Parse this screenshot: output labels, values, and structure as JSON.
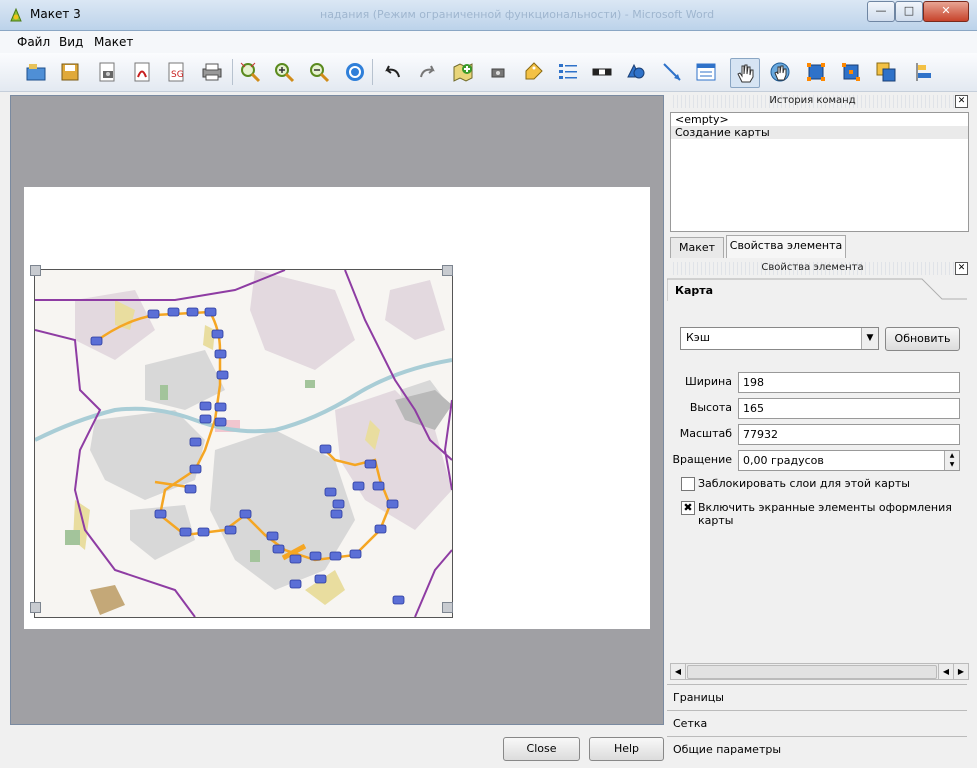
{
  "window": {
    "title": "Макет 3",
    "background_title": "надания (Режим ограниченной функциональности) - Microsoft Word",
    "minimize": "—",
    "maximize": "□",
    "close": "✕"
  },
  "menu": [
    "Файл",
    "Вид",
    "Макет"
  ],
  "toolbar": {
    "icons": [
      "open-folder-icon",
      "save-icon",
      "export-image-icon",
      "export-pdf-icon",
      "export-svg-icon",
      "print-icon",
      "zoom-full-icon",
      "zoom-in-icon",
      "zoom-out-icon",
      "refresh-icon",
      "undo-icon",
      "redo-icon",
      "add-map-icon",
      "add-image-icon",
      "add-label-icon",
      "add-legend-icon",
      "add-scalebar-icon",
      "add-shape-icon",
      "add-arrow-icon",
      "add-table-icon",
      "select-move-icon",
      "move-content-icon",
      "group-icon",
      "ungroup-icon",
      "raise-items-icon",
      "align-icon"
    ],
    "active": "select-move-icon"
  },
  "history_panel": {
    "title": "История команд",
    "items": [
      "<empty>",
      "Создание карты"
    ]
  },
  "tabs": [
    "Макет",
    "Свойства элемента"
  ],
  "properties_panel": {
    "title": "Свойства элемента",
    "section": "Карта",
    "cache_select": "Кэш",
    "update_button": "Обновить",
    "width_label": "Ширина",
    "width": "198",
    "height_label": "Высота",
    "height": "165",
    "scale_label": "Масштаб",
    "scale": "77932",
    "rotation_label": "Вращение",
    "rotation": "0,00 градусов",
    "lock_layers_label": "Заблокировать слои для этой карты",
    "lock_layers_checked": false,
    "draw_items_label": "Включить экранные элементы оформления карты",
    "draw_items_checked": true,
    "collapsed_sections": [
      "Границы",
      "Сетка",
      "Общие параметры"
    ]
  },
  "dialog_buttons": {
    "close": "Close",
    "help": "Help"
  },
  "colors": {
    "canvas_bg": "#a0a0a4",
    "boundary": "#8e3ca3",
    "metro_line": "#f5a623",
    "metro_station": "#5b6fd6",
    "river": "#a9cdd6"
  }
}
